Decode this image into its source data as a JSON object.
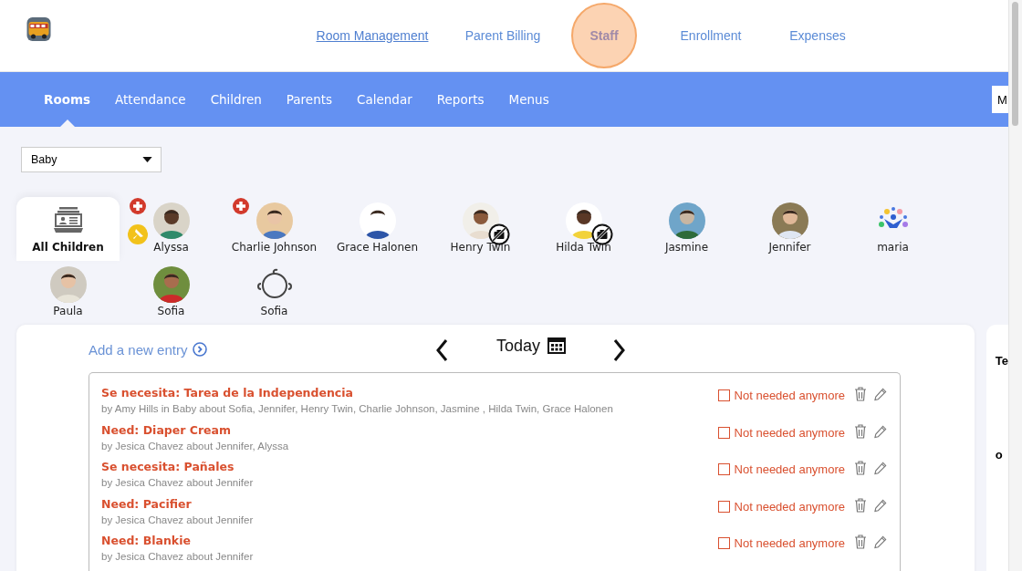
{
  "top_nav": [
    {
      "label": "Room Management",
      "underlined": true,
      "highlighted": false
    },
    {
      "label": "Parent Billing",
      "underlined": false,
      "highlighted": false
    },
    {
      "label": "Staff",
      "underlined": false,
      "highlighted": true
    },
    {
      "label": "Enrollment",
      "underlined": false,
      "highlighted": false
    },
    {
      "label": "Expenses",
      "underlined": false,
      "highlighted": false
    }
  ],
  "sub_nav": [
    {
      "label": "Rooms",
      "selected": true
    },
    {
      "label": "Attendance",
      "selected": false
    },
    {
      "label": "Children",
      "selected": false
    },
    {
      "label": "Parents",
      "selected": false
    },
    {
      "label": "Calendar",
      "selected": false
    },
    {
      "label": "Reports",
      "selected": false
    },
    {
      "label": "Menus",
      "selected": false
    }
  ],
  "sub_nav_button": "M",
  "room_select": {
    "value": "Baby"
  },
  "all_children": {
    "label": "All Children",
    "selected": true
  },
  "children": [
    {
      "name": "Alyssa",
      "medical_alert": true,
      "pinned": true,
      "no_photo": false
    },
    {
      "name": "Charlie Johnson",
      "medical_alert": true,
      "pinned": false,
      "no_photo": false
    },
    {
      "name": "Grace Halonen",
      "medical_alert": false,
      "pinned": false,
      "no_photo": false
    },
    {
      "name": "Henry Twin",
      "medical_alert": false,
      "pinned": false,
      "no_photo": true
    },
    {
      "name": "Hilda Twin",
      "medical_alert": false,
      "pinned": false,
      "no_photo": true
    },
    {
      "name": "Jasmine",
      "medical_alert": false,
      "pinned": false,
      "no_photo": false
    },
    {
      "name": "Jennifer",
      "medical_alert": false,
      "pinned": false,
      "no_photo": false
    },
    {
      "name": "maria",
      "kind": "logo",
      "medical_alert": false,
      "pinned": false,
      "no_photo": false
    },
    {
      "name": "Paula",
      "medical_alert": false,
      "pinned": false,
      "no_photo": false
    },
    {
      "name": "Sofia",
      "medical_alert": false,
      "pinned": false,
      "no_photo": false
    },
    {
      "name": "Sofia",
      "kind": "placeholder",
      "medical_alert": false,
      "pinned": false,
      "no_photo": false
    }
  ],
  "entries_panel": {
    "add_link": "Add a new entry",
    "date_label": "Today",
    "entries": [
      {
        "title": "Se necesita: Tarea de la Independencia",
        "byline": "by Amy Hills in Baby about Sofia, Jennifer, Henry Twin, Charlie Johnson, Jasmine , Hilda Twin, Grace Halonen",
        "checked": false,
        "check_label": "Not needed anymore"
      },
      {
        "title": "Need: Diaper Cream",
        "byline": "by Jesica Chavez about Jennifer, Alyssa",
        "checked": false,
        "check_label": "Not needed anymore"
      },
      {
        "title": "Se necesita: Pañales",
        "byline": "by Jesica Chavez about Jennifer",
        "checked": false,
        "check_label": "Not needed anymore"
      },
      {
        "title": "Need: Pacifier",
        "byline": "by Jesica Chavez about Jennifer",
        "checked": false,
        "check_label": "Not needed anymore"
      },
      {
        "title": "Need: Blankie",
        "byline": "by Jesica Chavez about Jennifer",
        "checked": false,
        "check_label": "Not needed anymore"
      }
    ]
  },
  "side_panel": {
    "texts": [
      "Te",
      "o"
    ]
  }
}
